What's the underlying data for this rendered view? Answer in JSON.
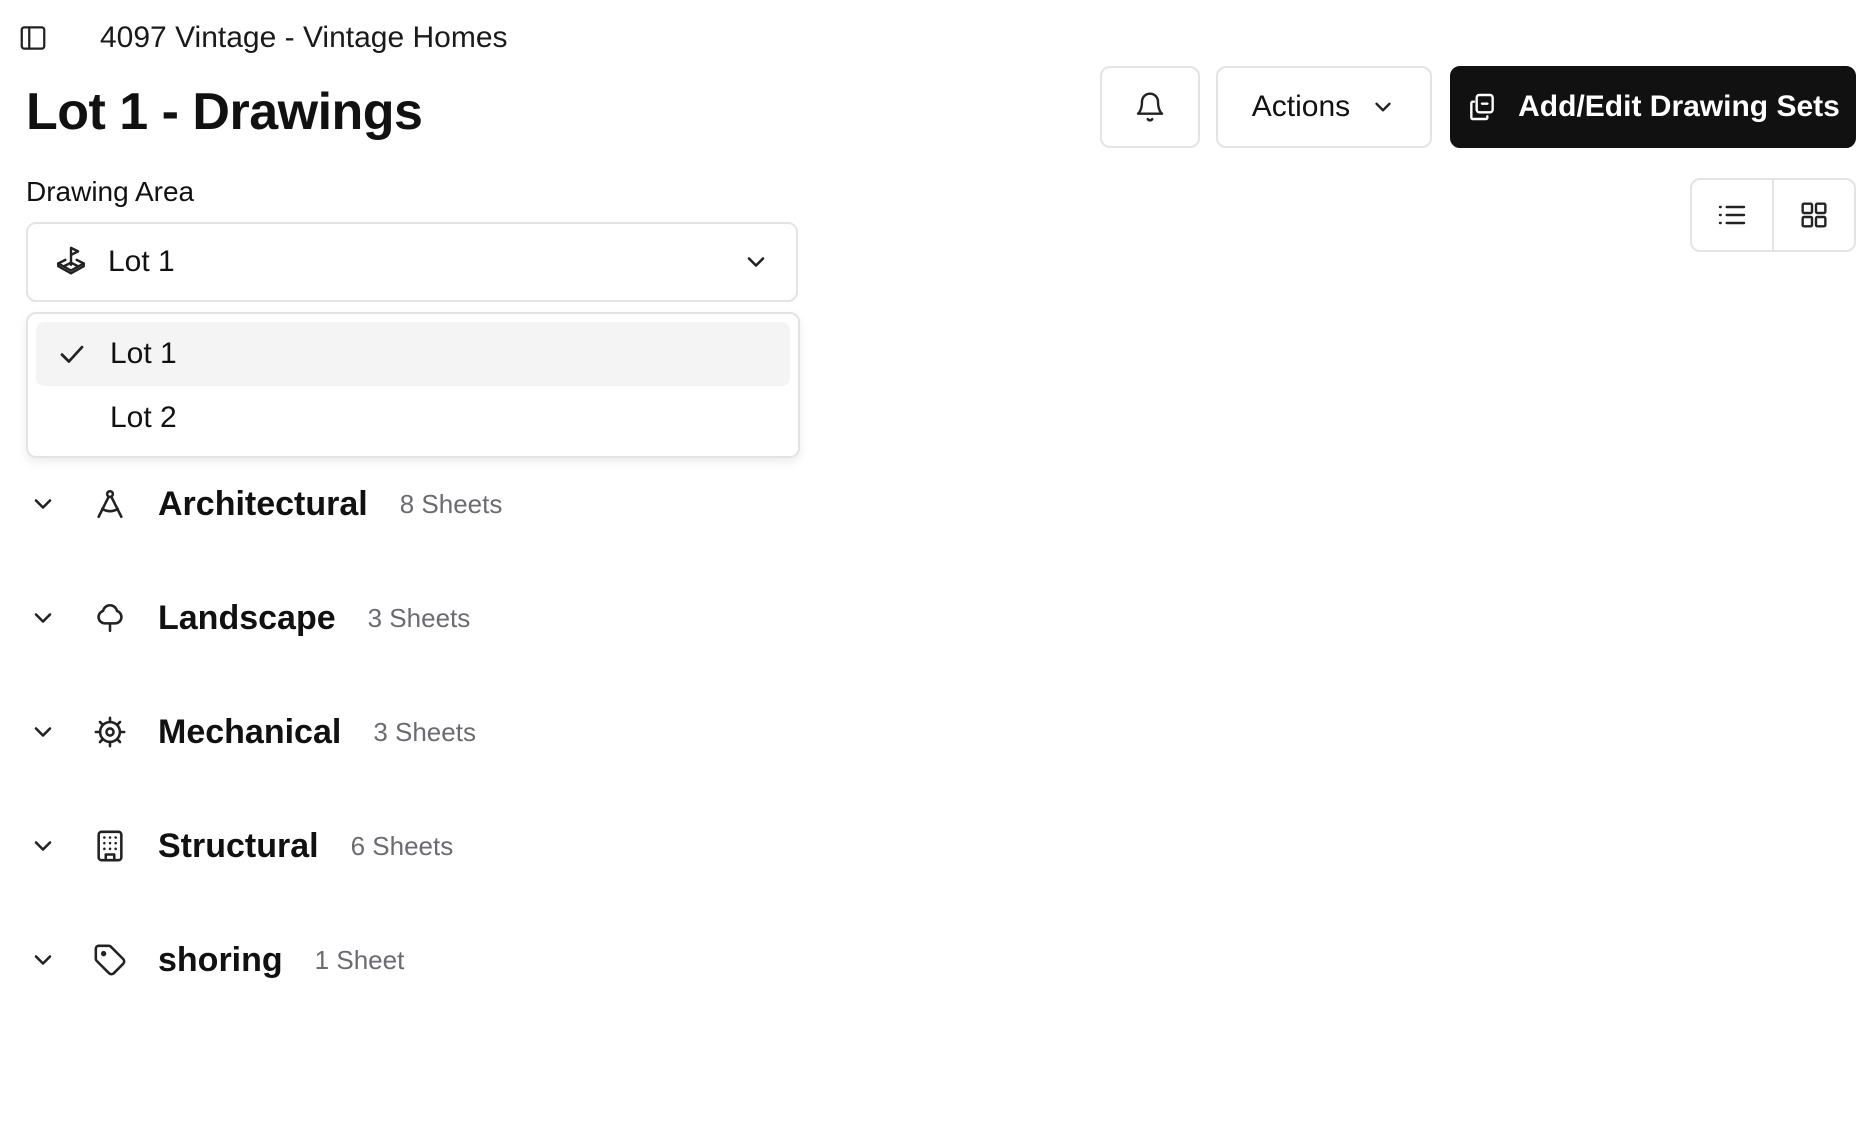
{
  "header": {
    "project_title": "4097 Vintage - Vintage Homes",
    "page_title": "Lot 1 - Drawings"
  },
  "toolbar": {
    "actions_label": "Actions",
    "add_edit_label": "Add/Edit Drawing Sets"
  },
  "drawing_area": {
    "label": "Drawing Area",
    "selected": "Lot 1",
    "options": [
      {
        "label": "Lot 1",
        "selected": true
      },
      {
        "label": "Lot 2",
        "selected": false
      }
    ]
  },
  "categories": [
    {
      "name": "Architectural",
      "count": "8 Sheets",
      "icon": "compass-icon"
    },
    {
      "name": "Landscape",
      "count": "3 Sheets",
      "icon": "tree-icon"
    },
    {
      "name": "Mechanical",
      "count": "3 Sheets",
      "icon": "cog-icon"
    },
    {
      "name": "Structural",
      "count": "6 Sheets",
      "icon": "building-icon"
    },
    {
      "name": "shoring",
      "count": "1 Sheet",
      "icon": "tag-icon"
    }
  ],
  "colors": {
    "primary_button": "#111111",
    "border": "#e4e4e7",
    "muted_text": "#6b6b70",
    "selected_option_bg": "#f4f4f5"
  }
}
